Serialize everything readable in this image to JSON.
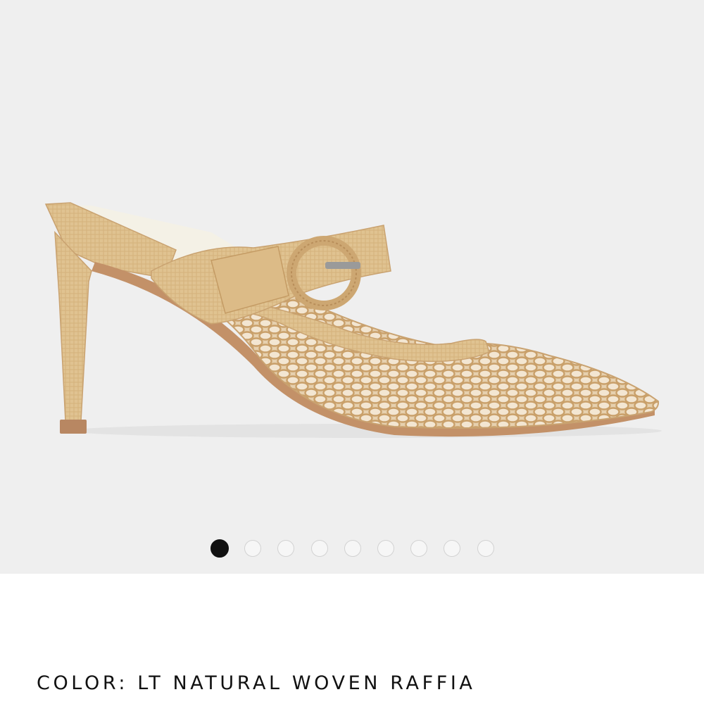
{
  "product": {
    "image_alt": "Woven raffia pointed-toe mule with buckle strap",
    "color_label": "COLOR:",
    "color_value": "LT NATURAL WOVEN RAFFIA"
  },
  "gallery": {
    "dot_count": 9,
    "active_index": 0
  },
  "colors": {
    "background": "#efefef",
    "raffia": "#e2c28f",
    "sole": "#b88762",
    "active_dot": "#111111"
  }
}
